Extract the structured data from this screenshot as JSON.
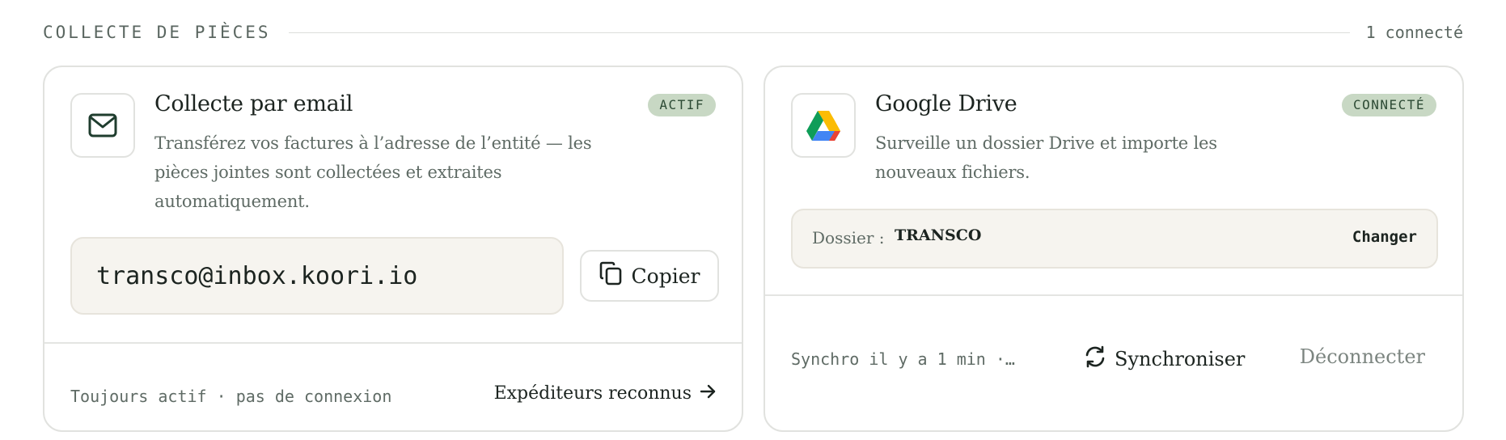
{
  "section": {
    "title": "COLLECTE DE PIÈCES",
    "count": "1 connecté"
  },
  "email_card": {
    "icon": "mail-icon",
    "title": "Collecte par email",
    "badge": "ACTIF",
    "description": "Transférez vos factures à l’adresse de l’entité — les pièces jointes sont collectées et extraites automatiquement.",
    "address": "transco@inbox.koori.io",
    "copy_label": "Copier",
    "copy_icon": "copy-icon",
    "status": "Toujours actif · pas de connexion",
    "link_label": "Expéditeurs reconnus",
    "link_icon": "arrow-right-icon"
  },
  "drive_card": {
    "icon": "google-drive-icon",
    "title": "Google Drive",
    "badge": "CONNECTÉ",
    "description": "Surveille un dossier Drive et importe les nouveaux fichiers.",
    "folder_label": "Dossier :",
    "folder_name": "TRANSCO",
    "change_label": "Changer",
    "sync_status": "Synchro il y a 1 min ·…",
    "sync_label": "Synchroniser",
    "sync_icon": "refresh-icon",
    "disconnect_label": "Déconnecter"
  },
  "colors": {
    "badge_bg": "#c8d8c4",
    "badge_text": "#2c4a34",
    "box_bg": "#f6f4ef",
    "border": "#e1e2df",
    "text_muted": "#5f6b65"
  }
}
